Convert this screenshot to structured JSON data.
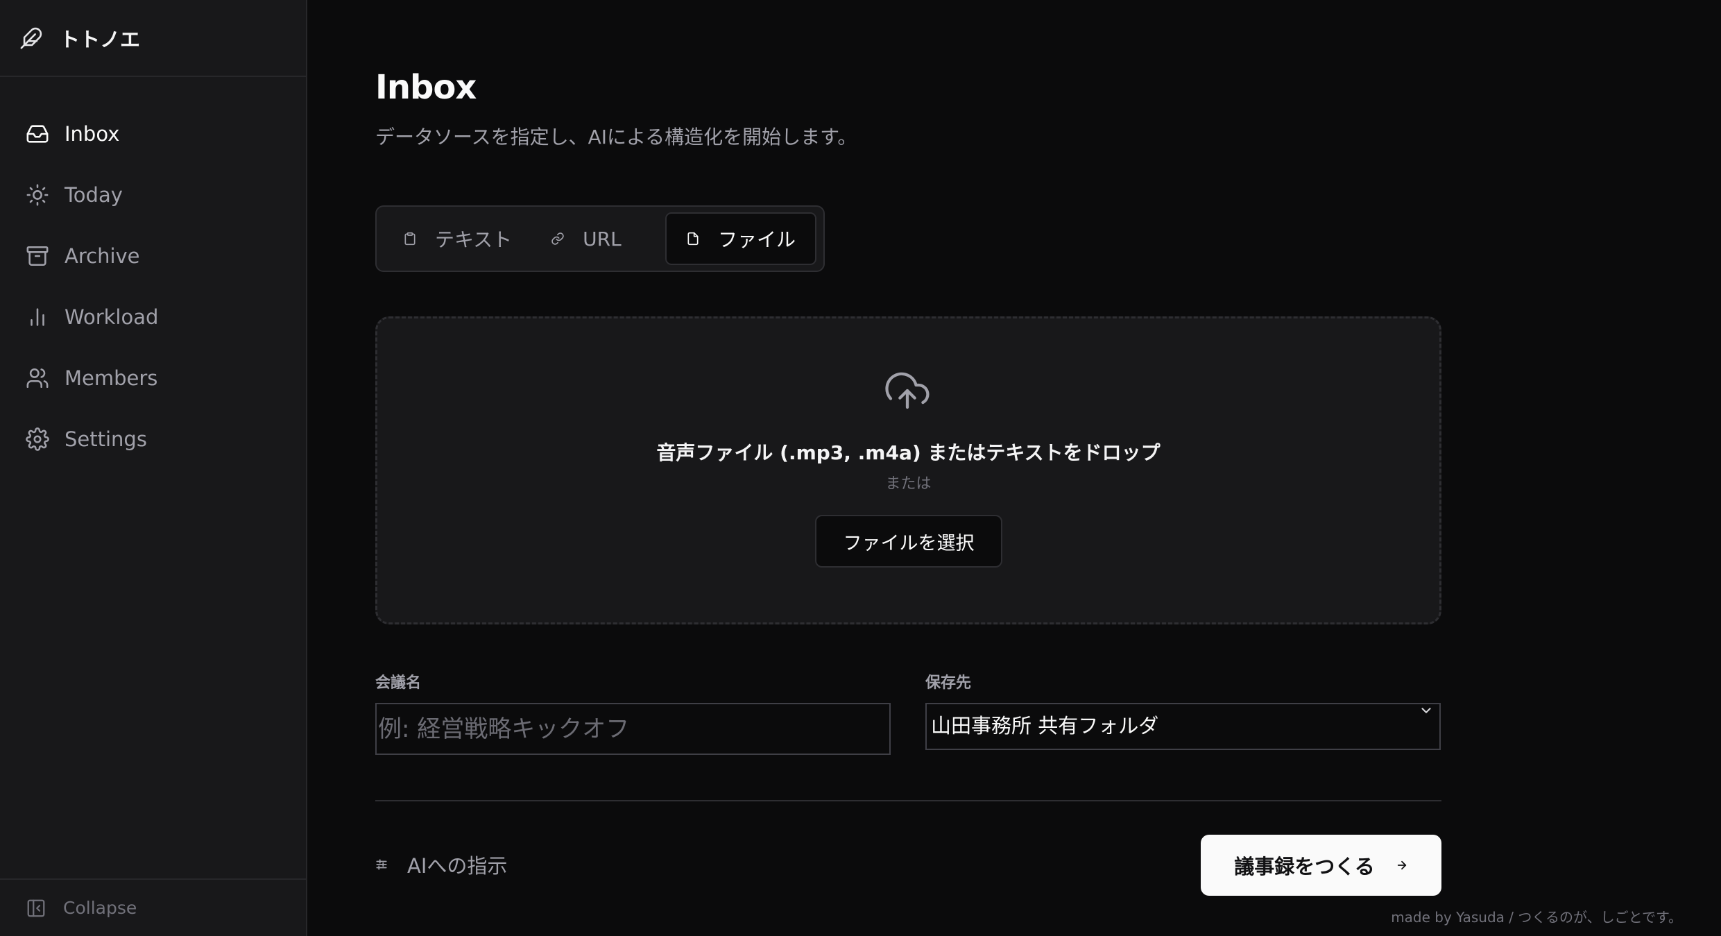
{
  "sidebar": {
    "brand": "トトノエ",
    "items": [
      {
        "label": "Inbox",
        "icon": "inbox-icon",
        "active": true
      },
      {
        "label": "Today",
        "icon": "sun-icon"
      },
      {
        "label": "Archive",
        "icon": "archive-icon"
      },
      {
        "label": "Workload",
        "icon": "bar-chart-icon"
      },
      {
        "label": "Members",
        "icon": "users-icon"
      },
      {
        "label": "Settings",
        "icon": "gear-icon"
      }
    ],
    "collapse_label": "Collapse"
  },
  "main": {
    "title": "Inbox",
    "subtitle": "データソースを指定し、AIによる構造化を開始します。",
    "tabs": [
      {
        "label": "テキスト",
        "icon": "clipboard-icon"
      },
      {
        "label": "URL",
        "icon": "link-icon"
      },
      {
        "label": "ファイル",
        "icon": "file-icon",
        "active": true
      }
    ],
    "dropzone": {
      "text": "音声ファイル (.mp3, .m4a) またはテキストをドロップ",
      "or": "または",
      "button": "ファイルを選択"
    },
    "form": {
      "meeting_label": "会議名",
      "meeting_placeholder": "例: 経営戦略キックオフ",
      "meeting_value": "",
      "dest_label": "保存先",
      "dest_value": "山田事務所 共有フォルダ"
    },
    "ai_instruction": "AIへの指示",
    "create_button": "議事録をつくる"
  },
  "footer": "made by Yasuda / つくるのが、しごとです。",
  "colors": {
    "background": "#0b0b0c",
    "sidebar": "#18181a",
    "accent": "#fafafa"
  }
}
